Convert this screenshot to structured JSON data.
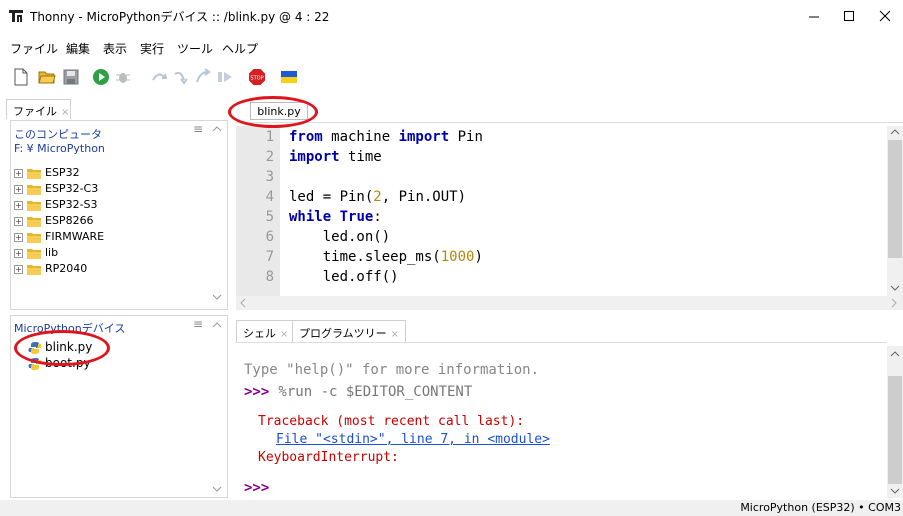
{
  "window": {
    "title": "Thonny  -  MicroPythonデバイス :: /blink.py  @  4 : 22"
  },
  "menu": [
    "ファイル",
    "編集",
    "表示",
    "実行",
    "ツール",
    "ヘルプ"
  ],
  "toolbar": {
    "icons": [
      "new-file-icon",
      "open-folder-icon",
      "save-icon",
      "run-icon",
      "debug-icon",
      "step-over-icon",
      "step-into-icon",
      "step-out-icon",
      "resume-icon",
      "stop-icon",
      "ukraine-flag-icon"
    ]
  },
  "files_tab": {
    "label": "ファイル",
    "close": "×"
  },
  "files": {
    "computer_title": "このコンピュータ",
    "computer_path": "F: ¥ MicroPython",
    "folders": [
      "ESP32",
      "ESP32-C3",
      "ESP32-S3",
      "ESP8266",
      "FIRMWARE",
      "lib",
      "RP2040"
    ],
    "device_title": "MicroPythonデバイス",
    "device_files": [
      "blink.py",
      "boot.py"
    ]
  },
  "editor": {
    "tab": "blink.py",
    "line_numbers": [
      "1",
      "2",
      "3",
      "4",
      "5",
      "6",
      "7",
      "8"
    ],
    "lines": [
      [
        {
          "t": "from",
          "c": "kw"
        },
        {
          "t": " machine ",
          "c": ""
        },
        {
          "t": "import",
          "c": "kw"
        },
        {
          "t": " Pin",
          "c": ""
        }
      ],
      [
        {
          "t": "import",
          "c": "kw"
        },
        {
          "t": " time",
          "c": ""
        }
      ],
      [],
      [
        {
          "t": "led = Pin(",
          "c": ""
        },
        {
          "t": "2",
          "c": "num"
        },
        {
          "t": ", Pin.OUT)",
          "c": ""
        }
      ],
      [
        {
          "t": "while",
          "c": "kw"
        },
        {
          "t": " ",
          "c": ""
        },
        {
          "t": "True",
          "c": "kw"
        },
        {
          "t": ":",
          "c": ""
        }
      ],
      [
        {
          "t": "    led.on()",
          "c": ""
        }
      ],
      [
        {
          "t": "    time.sleep_ms(",
          "c": ""
        },
        {
          "t": "1000",
          "c": "num"
        },
        {
          "t": ")",
          "c": ""
        }
      ],
      [
        {
          "t": "    led.off()",
          "c": ""
        }
      ]
    ]
  },
  "shell": {
    "tabs": [
      "シェル",
      "プログラムツリー"
    ],
    "close": "×",
    "help_line": "Type \"help()\" for more information.",
    "prompt": ">>>",
    "command": " %run -c $EDITOR_CONTENT",
    "traceback": "Traceback (most recent call last):",
    "file_link": "File \"<stdin>\", line 7, in <module>",
    "error": "KeyboardInterrupt:",
    "final_prompt": ">>>"
  },
  "status": {
    "text": "MicroPython (ESP32)  •  COM3"
  },
  "colors": {
    "keyword": "#0000aa",
    "number": "#b8860b",
    "error": "#cc0000",
    "link": "#1a4fd6",
    "prompt": "#8b008b",
    "annotation": "#e0141b"
  }
}
